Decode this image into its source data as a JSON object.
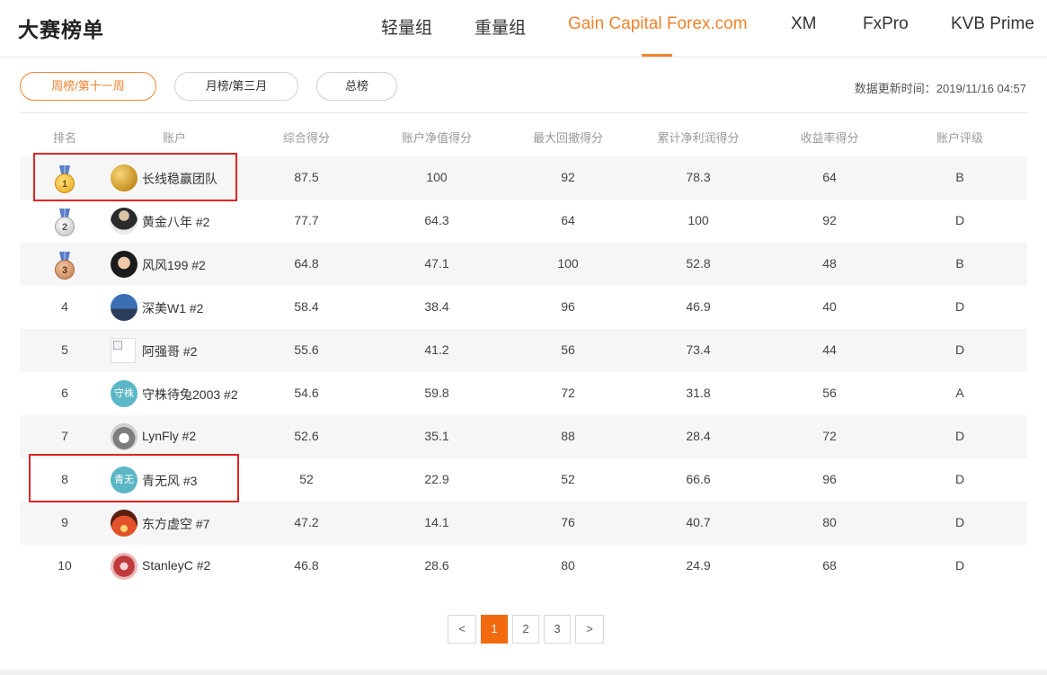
{
  "header": {
    "title": "大赛榜单",
    "tabs": [
      {
        "label": "轻量组",
        "active": false
      },
      {
        "label": "重量组",
        "active": false
      },
      {
        "label": "Gain Capital Forex.com",
        "active": true
      },
      {
        "label": "XM",
        "active": false
      },
      {
        "label": "FxPro",
        "active": false
      },
      {
        "label": "KVB Prime",
        "active": false
      }
    ]
  },
  "filters": [
    {
      "label": "周榜/第十一周",
      "active": true
    },
    {
      "label": "月榜/第三月",
      "active": false
    },
    {
      "label": "总榜",
      "active": false
    }
  ],
  "update_time": "数据更新时间：2019/11/16 04:57",
  "table": {
    "columns": [
      "排名",
      "账户",
      "综合得分",
      "账户净值得分",
      "最大回撤得分",
      "累计净利润得分",
      "收益率得分",
      "账户评级"
    ],
    "rows": [
      {
        "rank": "1",
        "medal": "gold",
        "avatar": "gold-coins",
        "avatar_text": "",
        "name": "长线稳赢团队",
        "score": "87.5",
        "equity": "100",
        "drawdown": "92",
        "profit": "78.3",
        "return": "64",
        "rating": "B"
      },
      {
        "rank": "2",
        "medal": "silver",
        "avatar": "suit",
        "avatar_text": "",
        "name": "黄金八年 #2",
        "score": "77.7",
        "equity": "64.3",
        "drawdown": "64",
        "profit": "100",
        "return": "92",
        "rating": "D"
      },
      {
        "rank": "3",
        "medal": "bronze",
        "avatar": "face",
        "avatar_text": "",
        "name": "风风199 #2",
        "score": "64.8",
        "equity": "47.1",
        "drawdown": "100",
        "profit": "52.8",
        "return": "48",
        "rating": "B"
      },
      {
        "rank": "4",
        "medal": "",
        "avatar": "sky",
        "avatar_text": "",
        "name": "深美W1 #2",
        "score": "58.4",
        "equity": "38.4",
        "drawdown": "96",
        "profit": "46.9",
        "return": "40",
        "rating": "D"
      },
      {
        "rank": "5",
        "medal": "",
        "avatar": "broken",
        "avatar_text": "",
        "name": "阿强哥 #2",
        "score": "55.6",
        "equity": "41.2",
        "drawdown": "56",
        "profit": "73.4",
        "return": "44",
        "rating": "D"
      },
      {
        "rank": "6",
        "medal": "",
        "avatar": "text",
        "avatar_text": "守株",
        "name": "守株待兔2003 #2",
        "score": "54.6",
        "equity": "59.8",
        "drawdown": "72",
        "profit": "31.8",
        "return": "56",
        "rating": "A"
      },
      {
        "rank": "7",
        "medal": "",
        "avatar": "husky",
        "avatar_text": "",
        "name": "LynFly #2",
        "score": "52.6",
        "equity": "35.1",
        "drawdown": "88",
        "profit": "28.4",
        "return": "72",
        "rating": "D"
      },
      {
        "rank": "8",
        "medal": "",
        "avatar": "text",
        "avatar_text": "青无",
        "name": "青无风 #3",
        "score": "52",
        "equity": "22.9",
        "drawdown": "52",
        "profit": "66.6",
        "return": "96",
        "rating": "D"
      },
      {
        "rank": "9",
        "medal": "",
        "avatar": "sunset",
        "avatar_text": "",
        "name": "东方虚空 #7",
        "score": "47.2",
        "equity": "14.1",
        "drawdown": "76",
        "profit": "40.7",
        "return": "80",
        "rating": "D"
      },
      {
        "rank": "10",
        "medal": "",
        "avatar": "meat",
        "avatar_text": "",
        "name": "StanleyC #2",
        "score": "46.8",
        "equity": "28.6",
        "drawdown": "80",
        "profit": "24.9",
        "return": "68",
        "rating": "D"
      }
    ]
  },
  "pagination": {
    "prev": "<",
    "pages": [
      {
        "label": "1",
        "active": true
      },
      {
        "label": "2",
        "active": false
      },
      {
        "label": "3",
        "active": false
      }
    ],
    "next": ">"
  },
  "colors": {
    "accent": "#f0832d",
    "page_active": "#f26a0f",
    "highlight": "#e02424"
  }
}
